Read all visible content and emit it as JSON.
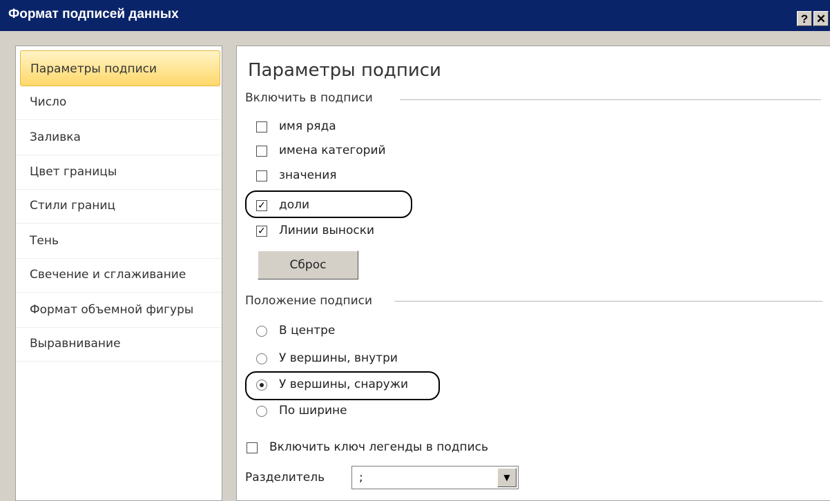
{
  "window": {
    "title": "Формат подписей данных",
    "help_label": "?",
    "close_label": "✕"
  },
  "sidebar": {
    "items": [
      {
        "label": "Параметры подписи",
        "selected": true
      },
      {
        "label": "Число"
      },
      {
        "label": "Заливка"
      },
      {
        "label": "Цвет границы"
      },
      {
        "label": "Стили границ"
      },
      {
        "label": "Тень"
      },
      {
        "label": "Свечение и сглаживание"
      },
      {
        "label": "Формат объемной фигуры"
      },
      {
        "label": "Выравнивание"
      }
    ]
  },
  "main": {
    "heading": "Параметры подписи",
    "include_section": "Включить в подписи",
    "checkboxes": [
      {
        "label": "имя ряда",
        "checked": false
      },
      {
        "label": "имена категорий",
        "checked": false
      },
      {
        "label": "значения",
        "checked": false
      },
      {
        "label": "доли",
        "checked": true
      },
      {
        "label": "Линии выноски",
        "checked": true
      }
    ],
    "reset_label": "Сброс",
    "position_section": "Положение подписи",
    "radios": [
      {
        "label": "В центре",
        "checked": false
      },
      {
        "label": "У вершины, внутри",
        "checked": false
      },
      {
        "label": "У вершины, снаружи",
        "checked": true
      },
      {
        "label": "По ширине",
        "checked": false
      }
    ],
    "legend_key_label": "Включить ключ легенды в подпись",
    "legend_key_checked": false,
    "separator_label": "Разделитель",
    "separator_value": ";"
  },
  "colors": {
    "title_bar": "#0a246a",
    "selection": "#ffd86b",
    "dialog_bg": "#d4d0c8"
  },
  "icons": [
    "help-icon",
    "close-icon",
    "checkmark-icon",
    "radio-dot-icon",
    "dropdown-arrow-icon"
  ]
}
